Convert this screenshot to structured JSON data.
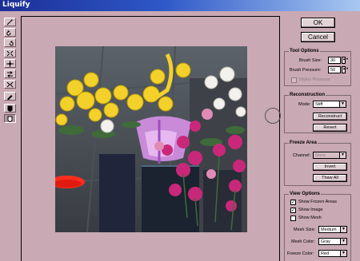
{
  "window": {
    "title": "Liquify"
  },
  "tools": [
    "warp-tool",
    "twirl-clockwise-tool",
    "twirl-counterclockwise-tool",
    "pucker-tool",
    "bloat-tool",
    "shift-pixels-tool",
    "reflection-tool",
    "reconstruct-tool",
    "freeze-tool",
    "thaw-tool"
  ],
  "buttons": {
    "ok": "OK",
    "cancel": "Cancel"
  },
  "tool_options": {
    "title": "Tool Options",
    "brush_size_label": "Brush Size:",
    "brush_size": "30",
    "brush_pressure_label": "Brush Pressure:",
    "brush_pressure": "50",
    "stylus_pressure_label": "Stylus Pressure"
  },
  "reconstruction": {
    "title": "Reconstruction",
    "mode_label": "Mode:",
    "mode": "Stiff",
    "reconstruct_btn": "Reconstruct",
    "revert_btn": "Revert"
  },
  "freeze_area": {
    "title": "Freeze Area",
    "channel_label": "Channel:",
    "channel": "None",
    "invert_btn": "Invert",
    "thaw_all_btn": "Thaw All"
  },
  "view_options": {
    "title": "View Options",
    "show_frozen_label": "Show Frozen Areas",
    "show_image_label": "Show Image",
    "show_mesh_label": "Show Mesh",
    "mesh_size_label": "Mesh Size:",
    "mesh_size": "Medium",
    "mesh_color_label": "Mesh Color:",
    "mesh_color": "Gray",
    "freeze_color_label": "Freeze Color:",
    "freeze_color": "Red"
  },
  "checkbox_mark": "✓",
  "spin_arrows": "▲▼",
  "dropdown_arrow": "▼"
}
